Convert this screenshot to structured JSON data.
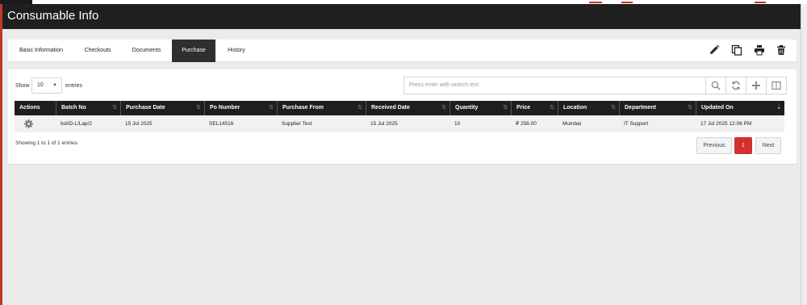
{
  "header": {
    "title": "Consumable Info"
  },
  "tabs": [
    {
      "label": "Basic Information"
    },
    {
      "label": "Checkouts"
    },
    {
      "label": "Documents"
    },
    {
      "label": "Purchase"
    },
    {
      "label": "History"
    }
  ],
  "active_tab": "Purchase",
  "toolbar": {
    "icons": [
      "edit-icon",
      "copy-icon",
      "print-icon",
      "delete-icon"
    ]
  },
  "table_controls": {
    "show_label": "Show",
    "entries_value": "10",
    "entries_label": "entries",
    "search_placeholder": "Press enter with search text",
    "buttons": [
      "search-icon",
      "refresh-icon",
      "add-icon",
      "columns-icon"
    ]
  },
  "table": {
    "columns": [
      "Actions",
      "Batch No",
      "Purchase Date",
      "Po Number",
      "Purchase From",
      "Received Date",
      "Quantity",
      "Price",
      "Location",
      "Department",
      "Updated On"
    ],
    "rows": [
      {
        "batch_no": "bol/D-L/Lap/2",
        "purchase_date": "15 Jul 2025",
        "po_number": "SEL14516",
        "purchase_from": "Supplier Test",
        "received_date": "15 Jul 2025",
        "quantity": "10",
        "price": "₽ 258.00",
        "location": "Mumbai",
        "department": "IT Support",
        "updated_on": "17 Jul 2025 12:06 PM"
      }
    ]
  },
  "pagination": {
    "info": "Showing 1 to 1 of 1 entries",
    "previous": "Previous",
    "current": "1",
    "next": "Next"
  },
  "colors": {
    "accent": "#d32f2f",
    "header_bg": "#1f1f1f",
    "table_head_bg": "#1e1e1e"
  }
}
